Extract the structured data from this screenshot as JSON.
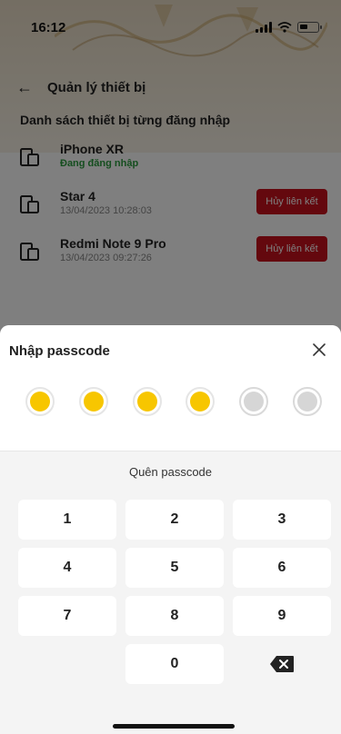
{
  "status_bar": {
    "time": "16:12"
  },
  "header": {
    "title": "Quản lý thiết bị"
  },
  "device_section": {
    "title": "Danh sách thiết bị từng đăng nhập",
    "devices": [
      {
        "name": "iPhone XR",
        "subtitle": "Đang đăng nhập",
        "active": true
      },
      {
        "name": "Star 4",
        "subtitle": "13/04/2023 10:28:03",
        "action": "Hủy liên kết"
      },
      {
        "name": "Redmi Note 9 Pro",
        "subtitle": "13/04/2023 09:27:26",
        "action": "Hủy liên kết"
      }
    ]
  },
  "passcode_sheet": {
    "title": "Nhập passcode",
    "digits_total": 6,
    "digits_entered": 4,
    "forgot_label": "Quên passcode",
    "keys": [
      "1",
      "2",
      "3",
      "4",
      "5",
      "6",
      "7",
      "8",
      "9",
      "0"
    ]
  },
  "colors": {
    "accent_yellow": "#f7c600",
    "danger_red": "#c9101c",
    "active_green": "#2a9d3e"
  }
}
